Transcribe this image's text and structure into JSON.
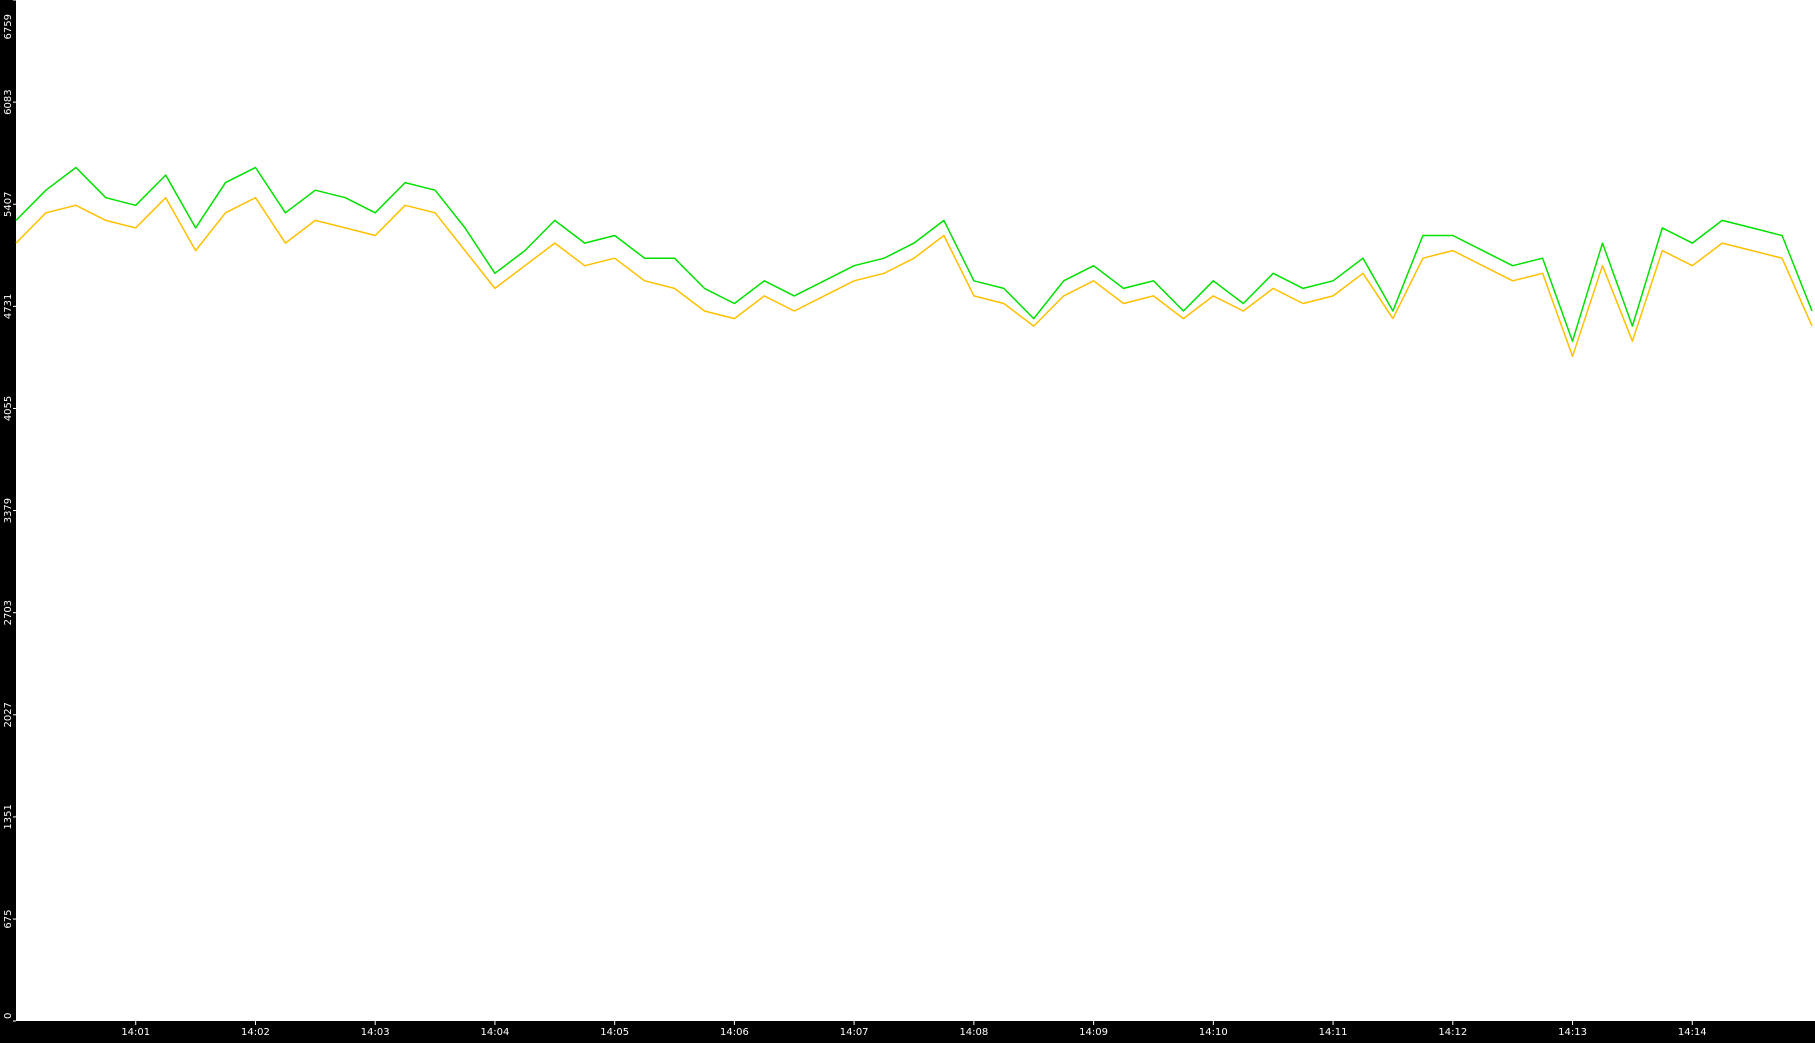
{
  "chart_data": {
    "type": "line",
    "title": "",
    "xlabel": "",
    "ylabel": "",
    "x_tick_labels": [
      "14:01",
      "14:02",
      "14:03",
      "14:04",
      "14:05",
      "14:06",
      "14:07",
      "14:08",
      "14:09",
      "14:10",
      "14:11",
      "14:12",
      "14:13",
      "14:14"
    ],
    "y_tick_labels": [
      "0",
      "675",
      "1351",
      "2027",
      "2703",
      "3379",
      "4055",
      "4731",
      "5407",
      "6083",
      "6759"
    ],
    "ylim": [
      0,
      6759
    ],
    "xlim_minutes": [
      0,
      15
    ],
    "grid": false,
    "series": [
      {
        "color": "#00e000",
        "points": [
          [
            0.0,
            5300
          ],
          [
            0.25,
            5500
          ],
          [
            0.5,
            5650
          ],
          [
            0.75,
            5450
          ],
          [
            1.0,
            5400
          ],
          [
            1.25,
            5600
          ],
          [
            1.5,
            5250
          ],
          [
            1.75,
            5550
          ],
          [
            2.0,
            5650
          ],
          [
            2.25,
            5350
          ],
          [
            2.5,
            5500
          ],
          [
            2.75,
            5450
          ],
          [
            3.0,
            5350
          ],
          [
            3.25,
            5550
          ],
          [
            3.5,
            5500
          ],
          [
            3.75,
            5250
          ],
          [
            4.0,
            4950
          ],
          [
            4.25,
            5100
          ],
          [
            4.5,
            5300
          ],
          [
            4.75,
            5150
          ],
          [
            5.0,
            5200
          ],
          [
            5.25,
            5050
          ],
          [
            5.5,
            5050
          ],
          [
            5.75,
            4850
          ],
          [
            6.0,
            4750
          ],
          [
            6.25,
            4900
          ],
          [
            6.5,
            4800
          ],
          [
            6.75,
            4900
          ],
          [
            7.0,
            5000
          ],
          [
            7.25,
            5050
          ],
          [
            7.5,
            5150
          ],
          [
            7.75,
            5300
          ],
          [
            8.0,
            4900
          ],
          [
            8.25,
            4850
          ],
          [
            8.5,
            4650
          ],
          [
            8.75,
            4900
          ],
          [
            9.0,
            5000
          ],
          [
            9.25,
            4850
          ],
          [
            9.5,
            4900
          ],
          [
            9.75,
            4700
          ],
          [
            10.0,
            4900
          ],
          [
            10.25,
            4750
          ],
          [
            10.5,
            4950
          ],
          [
            10.75,
            4850
          ],
          [
            11.0,
            4900
          ],
          [
            11.25,
            5050
          ],
          [
            11.5,
            4700
          ],
          [
            11.75,
            5200
          ],
          [
            12.0,
            5200
          ],
          [
            12.25,
            5100
          ],
          [
            12.5,
            5000
          ],
          [
            12.75,
            5050
          ],
          [
            13.0,
            4500
          ],
          [
            13.25,
            5150
          ],
          [
            13.5,
            4600
          ],
          [
            13.75,
            5250
          ],
          [
            14.0,
            5150
          ],
          [
            14.25,
            5300
          ],
          [
            14.5,
            5250
          ],
          [
            14.75,
            5200
          ],
          [
            15.0,
            4700
          ]
        ]
      },
      {
        "color": "#ffc000",
        "points": [
          [
            0.0,
            5150
          ],
          [
            0.25,
            5350
          ],
          [
            0.5,
            5400
          ],
          [
            0.75,
            5300
          ],
          [
            1.0,
            5250
          ],
          [
            1.25,
            5450
          ],
          [
            1.5,
            5100
          ],
          [
            1.75,
            5350
          ],
          [
            2.0,
            5450
          ],
          [
            2.25,
            5150
          ],
          [
            2.5,
            5300
          ],
          [
            2.75,
            5250
          ],
          [
            3.0,
            5200
          ],
          [
            3.25,
            5400
          ],
          [
            3.5,
            5350
          ],
          [
            3.75,
            5100
          ],
          [
            4.0,
            4850
          ],
          [
            4.25,
            5000
          ],
          [
            4.5,
            5150
          ],
          [
            4.75,
            5000
          ],
          [
            5.0,
            5050
          ],
          [
            5.25,
            4900
          ],
          [
            5.5,
            4850
          ],
          [
            5.75,
            4700
          ],
          [
            6.0,
            4650
          ],
          [
            6.25,
            4800
          ],
          [
            6.5,
            4700
          ],
          [
            6.75,
            4800
          ],
          [
            7.0,
            4900
          ],
          [
            7.25,
            4950
          ],
          [
            7.5,
            5050
          ],
          [
            7.75,
            5200
          ],
          [
            8.0,
            4800
          ],
          [
            8.25,
            4750
          ],
          [
            8.5,
            4600
          ],
          [
            8.75,
            4800
          ],
          [
            9.0,
            4900
          ],
          [
            9.25,
            4750
          ],
          [
            9.5,
            4800
          ],
          [
            9.75,
            4650
          ],
          [
            10.0,
            4800
          ],
          [
            10.25,
            4700
          ],
          [
            10.5,
            4850
          ],
          [
            10.75,
            4750
          ],
          [
            11.0,
            4800
          ],
          [
            11.25,
            4950
          ],
          [
            11.5,
            4650
          ],
          [
            11.75,
            5050
          ],
          [
            12.0,
            5100
          ],
          [
            12.25,
            5000
          ],
          [
            12.5,
            4900
          ],
          [
            12.75,
            4950
          ],
          [
            13.0,
            4400
          ],
          [
            13.25,
            5000
          ],
          [
            13.5,
            4500
          ],
          [
            13.75,
            5100
          ],
          [
            14.0,
            5000
          ],
          [
            14.25,
            5150
          ],
          [
            14.5,
            5100
          ],
          [
            14.75,
            5050
          ],
          [
            15.0,
            4600
          ]
        ]
      }
    ]
  }
}
